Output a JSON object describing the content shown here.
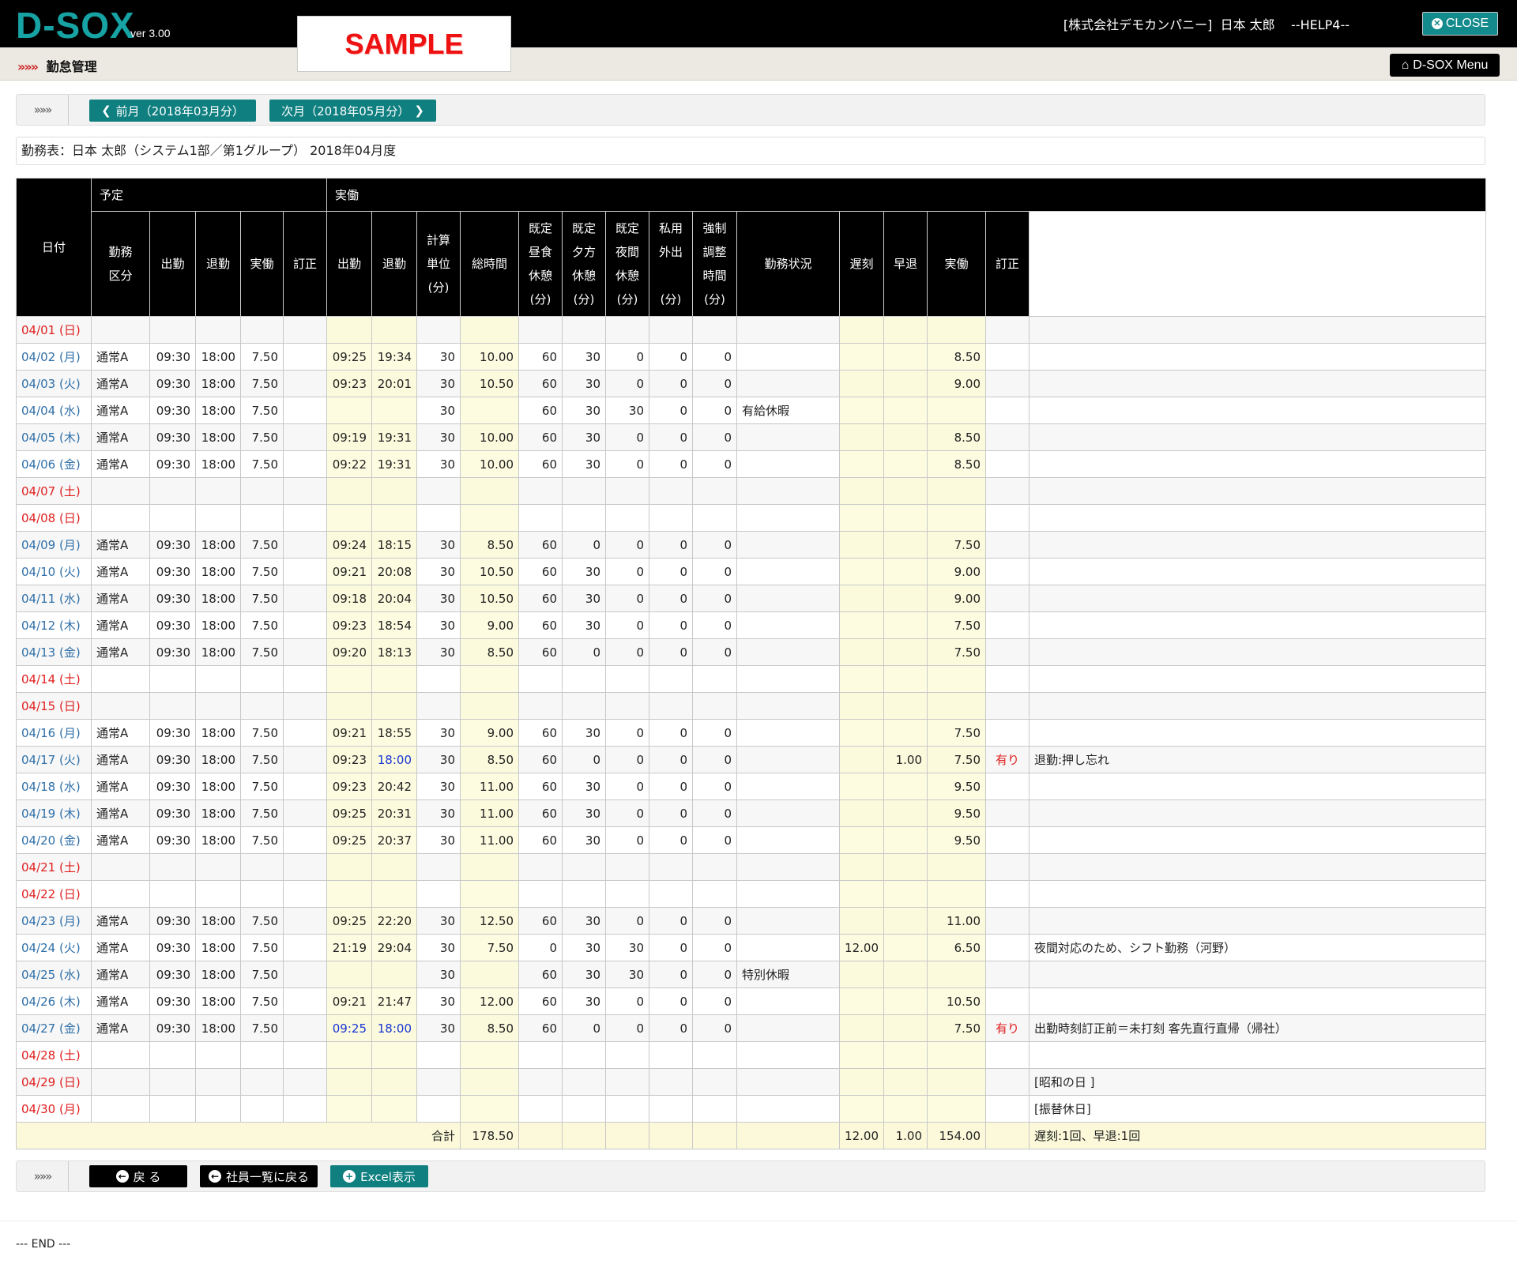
{
  "header": {
    "logo": "D-SOX",
    "version": "ver 3.00",
    "sample": "SAMPLE",
    "company": "[株式会社デモカンパニー]",
    "user": "日本 太郎",
    "help": "--HELP4--",
    "close_label": "CLOSE"
  },
  "subbar": {
    "arrows": "»»»",
    "title": "勤怠管理",
    "menu_label": "D-SOX Menu"
  },
  "nav": {
    "chev": "»»»",
    "prev_label": "前月（2018年03月分）",
    "next_label": "次月（2018年05月分）"
  },
  "sheet_title": "勤務表：日本 太郎（システム1部／第1グループ） 2018年04月度",
  "table": {
    "headers": {
      "date": "日付",
      "plan_group": "予定",
      "actual_group": "実働",
      "plan_type": "勤務\n区分",
      "plan_in": "出勤",
      "plan_out": "退勤",
      "plan_hours": "実働",
      "plan_fix": "訂正",
      "act_in": "出勤",
      "act_out": "退勤",
      "unit": "計算\n単位\n(分)",
      "total": "総時間",
      "lunch": "既定\n昼食\n休憩\n(分)",
      "evening": "既定\n夕方\n休憩\n(分)",
      "night": "既定\n夜間\n休憩\n(分)",
      "private": "私用\n外出\n\n(分)",
      "forced": "強制\n調整\n時間\n(分)",
      "status": "勤務状況",
      "late": "遅刻",
      "early": "早退",
      "act_hours": "実働",
      "act_fix": "訂正",
      "remarks": "備考"
    },
    "rows": [
      {
        "date": "04/01 (日)",
        "we": true,
        "type": "",
        "pin": "",
        "pout": "",
        "ph": "",
        "pf": "",
        "ain": "",
        "aout": "",
        "unit": "",
        "total": "",
        "lunch": "",
        "eve": "",
        "night": "",
        "priv": "",
        "forced": "",
        "status": "",
        "late": "",
        "early": "",
        "ah": "",
        "af": "",
        "rem": ""
      },
      {
        "date": "04/02 (月)",
        "we": false,
        "type": "通常A",
        "pin": "09:30",
        "pout": "18:00",
        "ph": "7.50",
        "pf": "",
        "ain": "09:25",
        "aout": "19:34",
        "unit": "30",
        "total": "10.00",
        "lunch": "60",
        "eve": "30",
        "night": "0",
        "priv": "0",
        "forced": "0",
        "status": "",
        "late": "",
        "early": "",
        "ah": "8.50",
        "af": "",
        "rem": ""
      },
      {
        "date": "04/03 (火)",
        "we": false,
        "type": "通常A",
        "pin": "09:30",
        "pout": "18:00",
        "ph": "7.50",
        "pf": "",
        "ain": "09:23",
        "aout": "20:01",
        "unit": "30",
        "total": "10.50",
        "lunch": "60",
        "eve": "30",
        "night": "0",
        "priv": "0",
        "forced": "0",
        "status": "",
        "late": "",
        "early": "",
        "ah": "9.00",
        "af": "",
        "rem": ""
      },
      {
        "date": "04/04 (水)",
        "we": false,
        "type": "通常A",
        "pin": "09:30",
        "pout": "18:00",
        "ph": "7.50",
        "pf": "",
        "ain": "",
        "aout": "",
        "unit": "30",
        "total": "",
        "lunch": "60",
        "eve": "30",
        "night": "30",
        "priv": "0",
        "forced": "0",
        "status": "有給休暇",
        "late": "",
        "early": "",
        "ah": "",
        "af": "",
        "rem": ""
      },
      {
        "date": "04/05 (木)",
        "we": false,
        "type": "通常A",
        "pin": "09:30",
        "pout": "18:00",
        "ph": "7.50",
        "pf": "",
        "ain": "09:19",
        "aout": "19:31",
        "unit": "30",
        "total": "10.00",
        "lunch": "60",
        "eve": "30",
        "night": "0",
        "priv": "0",
        "forced": "0",
        "status": "",
        "late": "",
        "early": "",
        "ah": "8.50",
        "af": "",
        "rem": ""
      },
      {
        "date": "04/06 (金)",
        "we": false,
        "type": "通常A",
        "pin": "09:30",
        "pout": "18:00",
        "ph": "7.50",
        "pf": "",
        "ain": "09:22",
        "aout": "19:31",
        "unit": "30",
        "total": "10.00",
        "lunch": "60",
        "eve": "30",
        "night": "0",
        "priv": "0",
        "forced": "0",
        "status": "",
        "late": "",
        "early": "",
        "ah": "8.50",
        "af": "",
        "rem": ""
      },
      {
        "date": "04/07 (土)",
        "we": true,
        "type": "",
        "pin": "",
        "pout": "",
        "ph": "",
        "pf": "",
        "ain": "",
        "aout": "",
        "unit": "",
        "total": "",
        "lunch": "",
        "eve": "",
        "night": "",
        "priv": "",
        "forced": "",
        "status": "",
        "late": "",
        "early": "",
        "ah": "",
        "af": "",
        "rem": ""
      },
      {
        "date": "04/08 (日)",
        "we": true,
        "type": "",
        "pin": "",
        "pout": "",
        "ph": "",
        "pf": "",
        "ain": "",
        "aout": "",
        "unit": "",
        "total": "",
        "lunch": "",
        "eve": "",
        "night": "",
        "priv": "",
        "forced": "",
        "status": "",
        "late": "",
        "early": "",
        "ah": "",
        "af": "",
        "rem": ""
      },
      {
        "date": "04/09 (月)",
        "we": false,
        "type": "通常A",
        "pin": "09:30",
        "pout": "18:00",
        "ph": "7.50",
        "pf": "",
        "ain": "09:24",
        "aout": "18:15",
        "unit": "30",
        "total": "8.50",
        "lunch": "60",
        "eve": "0",
        "night": "0",
        "priv": "0",
        "forced": "0",
        "status": "",
        "late": "",
        "early": "",
        "ah": "7.50",
        "af": "",
        "rem": ""
      },
      {
        "date": "04/10 (火)",
        "we": false,
        "type": "通常A",
        "pin": "09:30",
        "pout": "18:00",
        "ph": "7.50",
        "pf": "",
        "ain": "09:21",
        "aout": "20:08",
        "unit": "30",
        "total": "10.50",
        "lunch": "60",
        "eve": "30",
        "night": "0",
        "priv": "0",
        "forced": "0",
        "status": "",
        "late": "",
        "early": "",
        "ah": "9.00",
        "af": "",
        "rem": ""
      },
      {
        "date": "04/11 (水)",
        "we": false,
        "type": "通常A",
        "pin": "09:30",
        "pout": "18:00",
        "ph": "7.50",
        "pf": "",
        "ain": "09:18",
        "aout": "20:04",
        "unit": "30",
        "total": "10.50",
        "lunch": "60",
        "eve": "30",
        "night": "0",
        "priv": "0",
        "forced": "0",
        "status": "",
        "late": "",
        "early": "",
        "ah": "9.00",
        "af": "",
        "rem": ""
      },
      {
        "date": "04/12 (木)",
        "we": false,
        "type": "通常A",
        "pin": "09:30",
        "pout": "18:00",
        "ph": "7.50",
        "pf": "",
        "ain": "09:23",
        "aout": "18:54",
        "unit": "30",
        "total": "9.00",
        "lunch": "60",
        "eve": "30",
        "night": "0",
        "priv": "0",
        "forced": "0",
        "status": "",
        "late": "",
        "early": "",
        "ah": "7.50",
        "af": "",
        "rem": ""
      },
      {
        "date": "04/13 (金)",
        "we": false,
        "type": "通常A",
        "pin": "09:30",
        "pout": "18:00",
        "ph": "7.50",
        "pf": "",
        "ain": "09:20",
        "aout": "18:13",
        "unit": "30",
        "total": "8.50",
        "lunch": "60",
        "eve": "0",
        "night": "0",
        "priv": "0",
        "forced": "0",
        "status": "",
        "late": "",
        "early": "",
        "ah": "7.50",
        "af": "",
        "rem": ""
      },
      {
        "date": "04/14 (土)",
        "we": true,
        "type": "",
        "pin": "",
        "pout": "",
        "ph": "",
        "pf": "",
        "ain": "",
        "aout": "",
        "unit": "",
        "total": "",
        "lunch": "",
        "eve": "",
        "night": "",
        "priv": "",
        "forced": "",
        "status": "",
        "late": "",
        "early": "",
        "ah": "",
        "af": "",
        "rem": ""
      },
      {
        "date": "04/15 (日)",
        "we": true,
        "type": "",
        "pin": "",
        "pout": "",
        "ph": "",
        "pf": "",
        "ain": "",
        "aout": "",
        "unit": "",
        "total": "",
        "lunch": "",
        "eve": "",
        "night": "",
        "priv": "",
        "forced": "",
        "status": "",
        "late": "",
        "early": "",
        "ah": "",
        "af": "",
        "rem": ""
      },
      {
        "date": "04/16 (月)",
        "we": false,
        "type": "通常A",
        "pin": "09:30",
        "pout": "18:00",
        "ph": "7.50",
        "pf": "",
        "ain": "09:21",
        "aout": "18:55",
        "unit": "30",
        "total": "9.00",
        "lunch": "60",
        "eve": "30",
        "night": "0",
        "priv": "0",
        "forced": "0",
        "status": "",
        "late": "",
        "early": "",
        "ah": "7.50",
        "af": "",
        "rem": ""
      },
      {
        "date": "04/17 (火)",
        "we": false,
        "type": "通常A",
        "pin": "09:30",
        "pout": "18:00",
        "ph": "7.50",
        "pf": "",
        "ain": "09:23",
        "aout": "18:00",
        "aout_blue": true,
        "unit": "30",
        "total": "8.50",
        "lunch": "60",
        "eve": "0",
        "night": "0",
        "priv": "0",
        "forced": "0",
        "status": "",
        "late": "",
        "early": "1.00",
        "ah": "7.50",
        "af": "有り",
        "rem": "退勤:押し忘れ"
      },
      {
        "date": "04/18 (水)",
        "we": false,
        "type": "通常A",
        "pin": "09:30",
        "pout": "18:00",
        "ph": "7.50",
        "pf": "",
        "ain": "09:23",
        "aout": "20:42",
        "unit": "30",
        "total": "11.00",
        "lunch": "60",
        "eve": "30",
        "night": "0",
        "priv": "0",
        "forced": "0",
        "status": "",
        "late": "",
        "early": "",
        "ah": "9.50",
        "af": "",
        "rem": ""
      },
      {
        "date": "04/19 (木)",
        "we": false,
        "type": "通常A",
        "pin": "09:30",
        "pout": "18:00",
        "ph": "7.50",
        "pf": "",
        "ain": "09:25",
        "aout": "20:31",
        "unit": "30",
        "total": "11.00",
        "lunch": "60",
        "eve": "30",
        "night": "0",
        "priv": "0",
        "forced": "0",
        "status": "",
        "late": "",
        "early": "",
        "ah": "9.50",
        "af": "",
        "rem": ""
      },
      {
        "date": "04/20 (金)",
        "we": false,
        "type": "通常A",
        "pin": "09:30",
        "pout": "18:00",
        "ph": "7.50",
        "pf": "",
        "ain": "09:25",
        "aout": "20:37",
        "unit": "30",
        "total": "11.00",
        "lunch": "60",
        "eve": "30",
        "night": "0",
        "priv": "0",
        "forced": "0",
        "status": "",
        "late": "",
        "early": "",
        "ah": "9.50",
        "af": "",
        "rem": ""
      },
      {
        "date": "04/21 (土)",
        "we": true,
        "type": "",
        "pin": "",
        "pout": "",
        "ph": "",
        "pf": "",
        "ain": "",
        "aout": "",
        "unit": "",
        "total": "",
        "lunch": "",
        "eve": "",
        "night": "",
        "priv": "",
        "forced": "",
        "status": "",
        "late": "",
        "early": "",
        "ah": "",
        "af": "",
        "rem": ""
      },
      {
        "date": "04/22 (日)",
        "we": true,
        "type": "",
        "pin": "",
        "pout": "",
        "ph": "",
        "pf": "",
        "ain": "",
        "aout": "",
        "unit": "",
        "total": "",
        "lunch": "",
        "eve": "",
        "night": "",
        "priv": "",
        "forced": "",
        "status": "",
        "late": "",
        "early": "",
        "ah": "",
        "af": "",
        "rem": ""
      },
      {
        "date": "04/23 (月)",
        "we": false,
        "type": "通常A",
        "pin": "09:30",
        "pout": "18:00",
        "ph": "7.50",
        "pf": "",
        "ain": "09:25",
        "aout": "22:20",
        "unit": "30",
        "total": "12.50",
        "lunch": "60",
        "eve": "30",
        "night": "0",
        "priv": "0",
        "forced": "0",
        "status": "",
        "late": "",
        "early": "",
        "ah": "11.00",
        "af": "",
        "rem": ""
      },
      {
        "date": "04/24 (火)",
        "we": false,
        "type": "通常A",
        "pin": "09:30",
        "pout": "18:00",
        "ph": "7.50",
        "pf": "",
        "ain": "21:19",
        "aout": "29:04",
        "unit": "30",
        "total": "7.50",
        "lunch": "0",
        "eve": "30",
        "night": "30",
        "priv": "0",
        "forced": "0",
        "status": "",
        "late": "12.00",
        "early": "",
        "ah": "6.50",
        "af": "",
        "rem": "夜間対応のため、シフト勤務（河野）"
      },
      {
        "date": "04/25 (水)",
        "we": false,
        "type": "通常A",
        "pin": "09:30",
        "pout": "18:00",
        "ph": "7.50",
        "pf": "",
        "ain": "",
        "aout": "",
        "unit": "30",
        "total": "",
        "lunch": "60",
        "eve": "30",
        "night": "30",
        "priv": "0",
        "forced": "0",
        "status": "特別休暇",
        "late": "",
        "early": "",
        "ah": "",
        "af": "",
        "rem": ""
      },
      {
        "date": "04/26 (木)",
        "we": false,
        "type": "通常A",
        "pin": "09:30",
        "pout": "18:00",
        "ph": "7.50",
        "pf": "",
        "ain": "09:21",
        "aout": "21:47",
        "unit": "30",
        "total": "12.00",
        "lunch": "60",
        "eve": "30",
        "night": "0",
        "priv": "0",
        "forced": "0",
        "status": "",
        "late": "",
        "early": "",
        "ah": "10.50",
        "af": "",
        "rem": ""
      },
      {
        "date": "04/27 (金)",
        "we": false,
        "type": "通常A",
        "pin": "09:30",
        "pout": "18:00",
        "ph": "7.50",
        "pf": "",
        "ain": "09:25",
        "ain_blue": true,
        "aout": "18:00",
        "aout_blue": true,
        "unit": "30",
        "total": "8.50",
        "lunch": "60",
        "eve": "0",
        "night": "0",
        "priv": "0",
        "forced": "0",
        "status": "",
        "late": "",
        "early": "",
        "ah": "7.50",
        "af": "有り",
        "rem": "出勤時刻訂正前＝未打刻 客先直行直帰（帰社）"
      },
      {
        "date": "04/28 (土)",
        "we": true,
        "type": "",
        "pin": "",
        "pout": "",
        "ph": "",
        "pf": "",
        "ain": "",
        "aout": "",
        "unit": "",
        "total": "",
        "lunch": "",
        "eve": "",
        "night": "",
        "priv": "",
        "forced": "",
        "status": "",
        "late": "",
        "early": "",
        "ah": "",
        "af": "",
        "rem": ""
      },
      {
        "date": "04/29 (日)",
        "we": true,
        "type": "",
        "pin": "",
        "pout": "",
        "ph": "",
        "pf": "",
        "ain": "",
        "aout": "",
        "unit": "",
        "total": "",
        "lunch": "",
        "eve": "",
        "night": "",
        "priv": "",
        "forced": "",
        "status": "",
        "late": "",
        "early": "",
        "ah": "",
        "af": "",
        "rem": "[昭和の日 ]"
      },
      {
        "date": "04/30 (月)",
        "we": true,
        "type": "",
        "pin": "",
        "pout": "",
        "ph": "",
        "pf": "",
        "ain": "",
        "aout": "",
        "unit": "",
        "total": "",
        "lunch": "",
        "eve": "",
        "night": "",
        "priv": "",
        "forced": "",
        "status": "",
        "late": "",
        "early": "",
        "ah": "",
        "af": "",
        "rem": "[振替休日]"
      }
    ],
    "totals": {
      "label": "合計",
      "total": "178.50",
      "late": "12.00",
      "early": "1.00",
      "hours": "154.00",
      "remarks": "遅刻:1回、早退:1回"
    }
  },
  "footer_nav": {
    "chev": "»»»",
    "back_label": "戻 る",
    "list_label": "社員一覧に戻る",
    "excel_label": "Excel表示"
  },
  "end_text": "--- END ---",
  "colors": {
    "brand": "#17a2a4",
    "button_teal": "#0f7f80",
    "weekday": "#2f6fa8",
    "weekend": "#e02020",
    "highlight": "#fdfce1"
  }
}
